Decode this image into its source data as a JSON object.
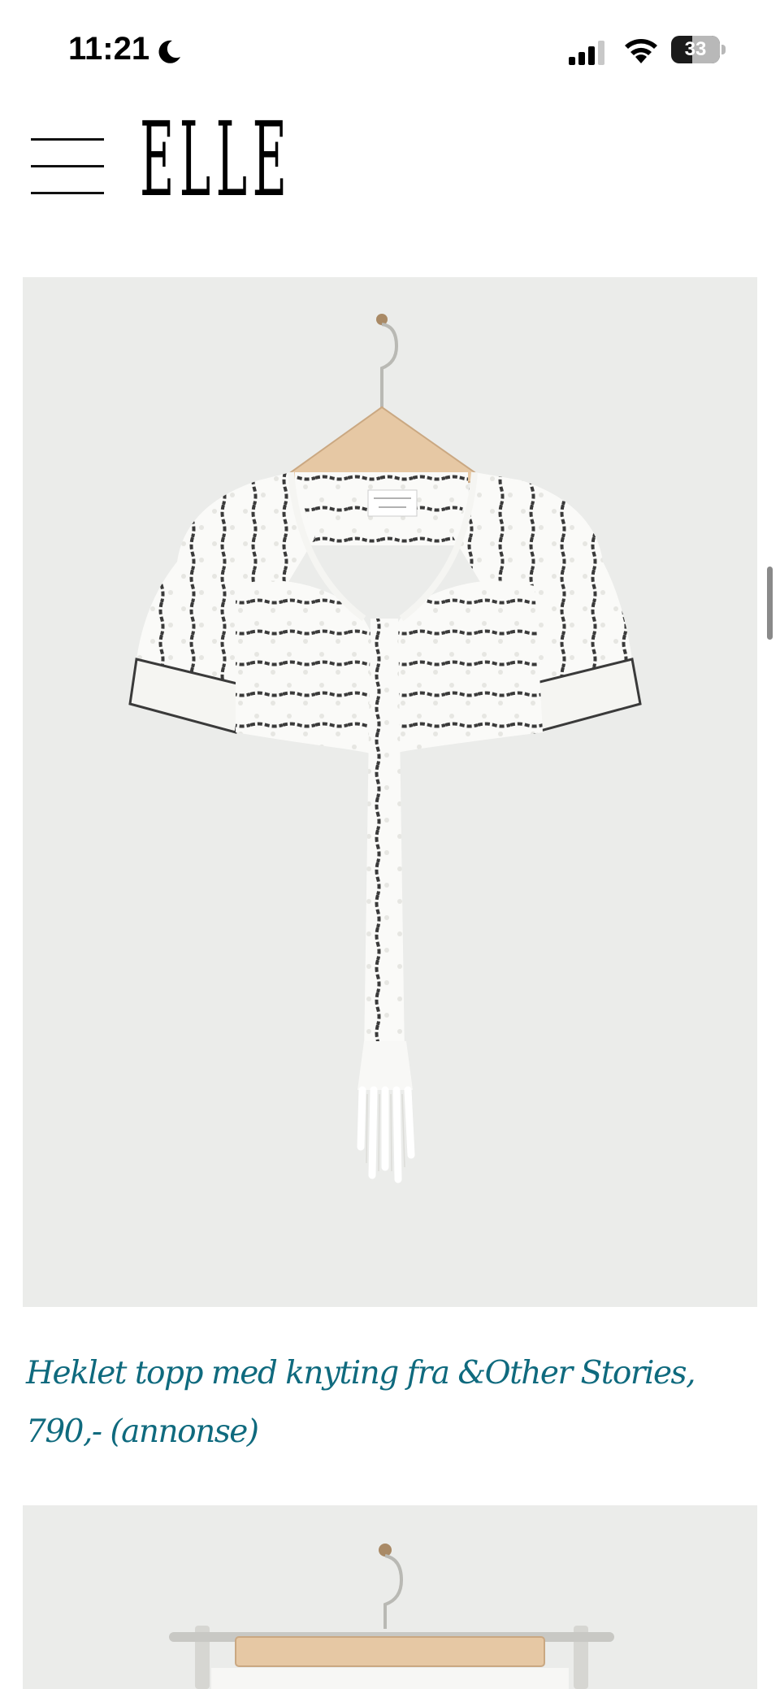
{
  "status_bar": {
    "time": "11:21",
    "battery_level": "33",
    "icons": [
      "moon-icon",
      "cellular-signal-icon",
      "wifi-icon",
      "battery-icon"
    ]
  },
  "header": {
    "logo": "ELLE",
    "menu_icon": "hamburger-menu-icon"
  },
  "article": {
    "product_image": {
      "subject": "white crochet top with black stripes and front tie on wooden hanger"
    },
    "product_caption": "Heklet topp med knyting fra &Other Stories, 790,- (annonse)",
    "next_image": {
      "subject": "garment on wooden hanger"
    }
  },
  "colors": {
    "link": "#0f6a7e",
    "image_background": "#ebecea",
    "text": "#000000"
  }
}
